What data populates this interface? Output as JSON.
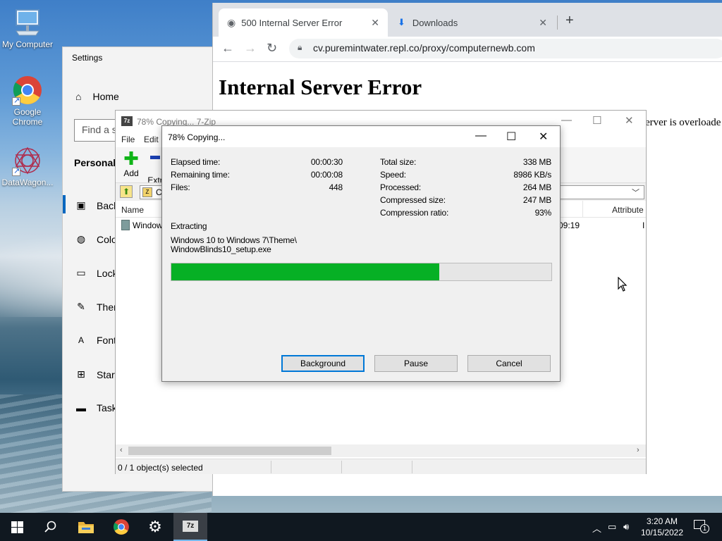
{
  "desktop": {
    "icons": [
      {
        "label": "My Computer",
        "icon": "computer-icon"
      },
      {
        "label": "Google Chrome",
        "icon": "chrome-icon"
      },
      {
        "label": "DataWagon...",
        "icon": "datawagon-icon"
      }
    ]
  },
  "settings": {
    "title": "Settings",
    "home": "Home",
    "search_placeholder": "Find a s",
    "section": "Personaliz",
    "nav": [
      {
        "label": "Back",
        "icon": "image-icon"
      },
      {
        "label": "Colo",
        "icon": "palette-icon"
      },
      {
        "label": "Lock",
        "icon": "lock-screen-icon"
      },
      {
        "label": "Ther",
        "icon": "theme-brush-icon"
      },
      {
        "label": "Fonts",
        "icon": "font-icon"
      },
      {
        "label": "Start",
        "icon": "start-grid-icon"
      },
      {
        "label": "Taskb",
        "icon": "taskbar-icon"
      }
    ]
  },
  "browser": {
    "tabs": [
      {
        "title": "500 Internal Server Error",
        "icon": "globe-icon"
      },
      {
        "title": "Downloads",
        "icon": "download-icon"
      }
    ],
    "new_tab": "+",
    "url": "cv.puremintwater.repl.co/proxy/computernewb.com",
    "page_heading": "Internal Server Error",
    "page_text": "erver is overloade"
  },
  "sevenzip": {
    "title": "78% Copying... 7-Zip",
    "menu": [
      "File",
      "Edit"
    ],
    "tools": [
      {
        "label": "Add",
        "icon": "plus-icon"
      },
      {
        "label": "Extr",
        "icon": "extract-icon"
      }
    ],
    "address": "C",
    "columns": {
      "name": "Name",
      "attributes": "Attribute"
    },
    "row": {
      "name": "Window",
      "time": "09:19",
      "attr": "I"
    },
    "status": "0 / 1 object(s) selected"
  },
  "dialog": {
    "title": "78% Copying...",
    "left_stats": [
      {
        "label": "Elapsed time:",
        "value": "00:00:30"
      },
      {
        "label": "Remaining time:",
        "value": "00:00:08"
      },
      {
        "label": "Files:",
        "value": "448"
      }
    ],
    "right_stats": [
      {
        "label": "Total size:",
        "value": "338 MB"
      },
      {
        "label": "Speed:",
        "value": "8986 KB/s"
      },
      {
        "label": "Processed:",
        "value": "264 MB"
      },
      {
        "label": "Compressed size:",
        "value": "247 MB"
      },
      {
        "label": "Compression ratio:",
        "value": "93%"
      }
    ],
    "operation": "Extracting",
    "file_line1": "Windows 10 to Windows 7\\Theme\\",
    "file_line2": "WindowBlinds10_setup.exe",
    "progress_fraction": 0.705,
    "progress_color": "#06b025",
    "buttons": {
      "background": "Background",
      "pause": "Pause",
      "cancel": "Cancel"
    }
  },
  "taskbar": {
    "time": "3:20 AM",
    "date": "10/15/2022",
    "notification_count": "1",
    "pinned": [
      "windows-start-icon",
      "search-icon",
      "file-explorer-icon",
      "chrome-icon",
      "settings-gear-icon",
      "7zip-icon"
    ]
  }
}
